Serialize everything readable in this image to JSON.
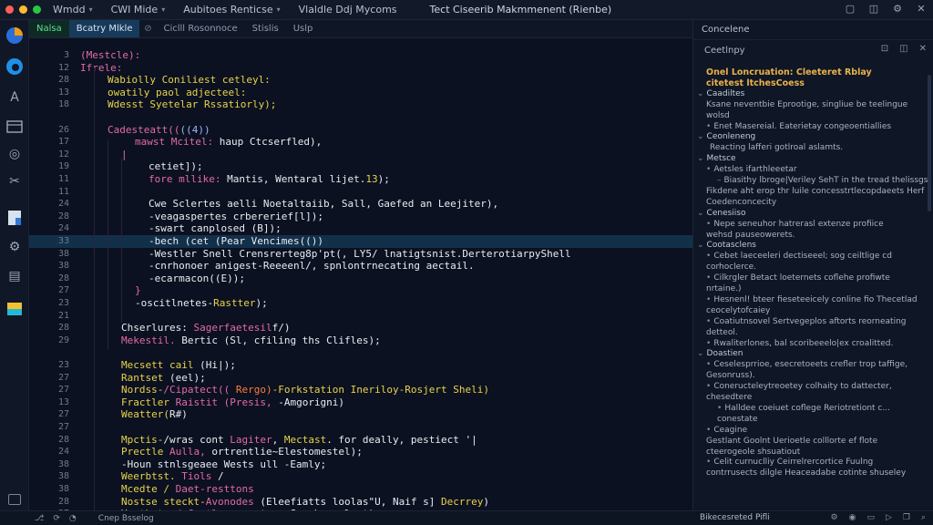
{
  "window": {
    "menus": [
      "Wmdd",
      "CWI Mide",
      "Aubitoes Renticse"
    ],
    "title": "Vlaldle Ddj Mycoms",
    "subtitle": "Tect Ciseerib Makmmenent (Rienbe)",
    "traffic_colors": [
      "#ff5f57",
      "#febc2e",
      "#28c840"
    ]
  },
  "activity_icons": [
    "browser-icon",
    "edge-icon",
    "text-icon",
    "terminal-icon",
    "target-icon",
    "tools-icon",
    "document-icon",
    "settings-icon",
    "file-icon",
    "extension-icon"
  ],
  "tabs": [
    {
      "label": "Nalsa",
      "style": "green"
    },
    {
      "label": "Bcatry Mlkle",
      "style": "active"
    },
    {
      "label": "Ciclll Rosonnoce",
      "style": "normal"
    },
    {
      "label": "Stislis",
      "style": "normal"
    },
    {
      "label": "Uslp",
      "style": "normal"
    }
  ],
  "code": [
    {
      "n": "3",
      "indent": 0,
      "segs": [
        [
          "(Mestcle):",
          "#e36aa8"
        ]
      ]
    },
    {
      "n": "12",
      "indent": 0,
      "segs": [
        [
          "Ifrele:",
          "#e36aa8"
        ]
      ]
    },
    {
      "n": "28",
      "indent": 2,
      "segs": [
        [
          "Wabiolly Coniliest cetleyl:",
          "#e9d34a"
        ]
      ]
    },
    {
      "n": "13",
      "indent": 2,
      "segs": [
        [
          "owatily paol adjecteel:",
          "#e9d34a"
        ]
      ]
    },
    {
      "n": "18",
      "indent": 2,
      "segs": [
        [
          "Wdesst Syetelar Rssatiorly);",
          "#e9d34a"
        ]
      ]
    },
    {
      "n": "",
      "indent": 0,
      "segs": []
    },
    {
      "n": "26",
      "indent": 2,
      "segs": [
        [
          "Cadesteatt((",
          "#e36aa8"
        ],
        [
          "((4))",
          "#9fb4ff"
        ]
      ]
    },
    {
      "n": "17",
      "indent": 4,
      "segs": [
        [
          "mawst Mcitel: ",
          "#e36aa8"
        ],
        [
          "haup Ctcserfled),",
          "#e8ecf2"
        ]
      ]
    },
    {
      "n": "12",
      "indent": 3,
      "segs": [
        [
          "|",
          "#e36aa8"
        ]
      ]
    },
    {
      "n": "19",
      "indent": 5,
      "segs": [
        [
          "cetiet]);",
          "#e8ecf2"
        ]
      ]
    },
    {
      "n": "11",
      "indent": 5,
      "segs": [
        [
          "fore mllike: ",
          "#e36aa8"
        ],
        [
          "Mantis, Wentaral lijet.",
          "#e8ecf2"
        ],
        [
          "13",
          "#e9d34a"
        ],
        [
          ");",
          "#e8ecf2"
        ]
      ]
    },
    {
      "n": "11",
      "indent": 0,
      "segs": []
    },
    {
      "n": "24",
      "indent": 5,
      "segs": [
        [
          "Cwe Sclertes aelli Noetaltaiib, Sall, Gaefed an Leejiter),",
          "#e8ecf2"
        ]
      ]
    },
    {
      "n": "28",
      "indent": 5,
      "segs": [
        [
          "-veagaspertes crbererief[l]);",
          "#e8ecf2"
        ]
      ]
    },
    {
      "n": "24",
      "indent": 5,
      "segs": [
        [
          "-swart canplosed (B]);",
          "#e8ecf2"
        ]
      ]
    },
    {
      "n": "33",
      "indent": 5,
      "segs": [
        [
          "-bech (cet (Pear Vencimes(())",
          "#e8ecf2"
        ]
      ],
      "hl": true
    },
    {
      "n": "38",
      "indent": 5,
      "segs": [
        [
          "-Westler Snell Crensrerteg8p'pt(, LY5/ lnatigtsnist.DerterotiarpyShell",
          "#e8ecf2"
        ]
      ]
    },
    {
      "n": "38",
      "indent": 5,
      "segs": [
        [
          "-cnrhonoer anigest-Reeeenl/, spnlontrnecating aectail.",
          "#e8ecf2"
        ]
      ]
    },
    {
      "n": "28",
      "indent": 5,
      "segs": [
        [
          "-ecarmacon((E));",
          "#e8ecf2"
        ]
      ]
    },
    {
      "n": "27",
      "indent": 4,
      "segs": [
        [
          "}",
          "#e36aa8"
        ]
      ]
    },
    {
      "n": "23",
      "indent": 4,
      "segs": [
        [
          "-oscitlnetes-",
          "#e8ecf2"
        ],
        [
          "Rastter",
          "#e9d34a"
        ],
        [
          ");",
          "#e8ecf2"
        ]
      ]
    },
    {
      "n": "21",
      "indent": 0,
      "segs": []
    },
    {
      "n": "28",
      "indent": 3,
      "segs": [
        [
          "Chserlures: ",
          "#e8ecf2"
        ],
        [
          "Sagerfaetesil",
          "#e36aa8"
        ],
        [
          "f/)",
          "#e8ecf2"
        ]
      ]
    },
    {
      "n": "29",
      "indent": 3,
      "segs": [
        [
          "Mekestil. ",
          "#e36aa8"
        ],
        [
          "Bertic (Sl, cfiling ths Clifles);",
          "#e8ecf2"
        ]
      ]
    },
    {
      "n": "",
      "indent": 0,
      "segs": []
    },
    {
      "n": "23",
      "indent": 3,
      "segs": [
        [
          "Mecsett cail ",
          "#e9d34a"
        ],
        [
          "(Hi|);",
          "#e8ecf2"
        ]
      ]
    },
    {
      "n": "27",
      "indent": 3,
      "segs": [
        [
          "Rantset ",
          "#e9d34a"
        ],
        [
          "(eel);",
          "#e8ecf2"
        ]
      ]
    },
    {
      "n": "27",
      "indent": 3,
      "segs": [
        [
          "Nordss-",
          "#e9d34a"
        ],
        [
          "/Cipatect((",
          "#e36aa8"
        ],
        [
          " Rergo)",
          "#ff7a3d"
        ],
        [
          "-Forkstation ",
          "#e9d34a"
        ],
        [
          "Ineriloy-Rosjert Sheli)",
          "#e9d34a"
        ]
      ]
    },
    {
      "n": "13",
      "indent": 3,
      "segs": [
        [
          "Fractler ",
          "#e9d34a"
        ],
        [
          "Raistit ",
          "#e36aa8"
        ],
        [
          "(Presis, ",
          "#e36aa8"
        ],
        [
          "-Amgorigni)",
          "#e8ecf2"
        ]
      ]
    },
    {
      "n": "27",
      "indent": 3,
      "segs": [
        [
          "Weatter(",
          "#e9d34a"
        ],
        [
          "R#)",
          "#e8ecf2"
        ]
      ]
    },
    {
      "n": "27",
      "indent": 0,
      "segs": []
    },
    {
      "n": "28",
      "indent": 3,
      "segs": [
        [
          "Mpctis-",
          "#e9d34a"
        ],
        [
          "/wras cont ",
          "#e8ecf2"
        ],
        [
          "Lagiter",
          "#e36aa8"
        ],
        [
          ", ",
          "#e8ecf2"
        ],
        [
          "Mectast",
          "#e9d34a"
        ],
        [
          ". for deally, pestiect '|",
          "#e8ecf2"
        ]
      ]
    },
    {
      "n": "24",
      "indent": 3,
      "segs": [
        [
          "Prectle ",
          "#e9d34a"
        ],
        [
          "Aulla, ",
          "#e36aa8"
        ],
        [
          "ortrentlie~Elestomestel);",
          "#e8ecf2"
        ]
      ]
    },
    {
      "n": "38",
      "indent": 3,
      "segs": [
        [
          "-Houn stnlsgeaee Wests ull -Eamly;",
          "#e8ecf2"
        ]
      ]
    },
    {
      "n": "38",
      "indent": 3,
      "segs": [
        [
          "Weerbtst. ",
          "#e9d34a"
        ],
        [
          "Tiols",
          "#e36aa8"
        ],
        [
          " /",
          "#e8ecf2"
        ]
      ]
    },
    {
      "n": "38",
      "indent": 3,
      "segs": [
        [
          "Mcedte / ",
          "#e9d34a"
        ],
        [
          "Daet-resttons",
          "#e36aa8"
        ]
      ]
    },
    {
      "n": "28",
      "indent": 3,
      "segs": [
        [
          "Nostse steckt-",
          "#e9d34a"
        ],
        [
          "Avonodes ",
          "#e36aa8"
        ],
        [
          "(Eleefiatts loolas\"U, Naif s] ",
          "#e8ecf2"
        ],
        [
          "Decrrey",
          "#e9d34a"
        ],
        [
          ")",
          "#e8ecf2"
        ]
      ]
    },
    {
      "n": "37",
      "indent": 3,
      "segs": [
        [
          "Vanthet ",
          "#e9d34a"
        ],
        [
          "s/-Ccatla--",
          "#e36aa8"
        ],
        [
          "amaets - Sogcheseolent);",
          "#e8ecf2"
        ]
      ]
    }
  ],
  "panel": {
    "header": "Concelene",
    "subheader": "Ceetlnpy",
    "rows": [
      {
        "kind": "title",
        "text": "Onel Loncruation: Cleeteret Rblay"
      },
      {
        "kind": "title",
        "text": "citetest ltchesCoess"
      },
      {
        "kind": "section",
        "text": "Caadiltes",
        "arrow": "⌄"
      },
      {
        "kind": "item",
        "text": "Ksane neventbie Eprootige, singliue be teelingue",
        "pad": 14
      },
      {
        "kind": "item",
        "text": "wolsd",
        "pad": 14
      },
      {
        "kind": "item",
        "text": "Enet Masereial. Eaterietay congeoentiallies",
        "pad": 14,
        "arrow": "•"
      },
      {
        "kind": "section",
        "text": "Ceonleneng",
        "arrow": "⌄"
      },
      {
        "kind": "item",
        "text": "Reacting lafferi gotlroal aslamts.",
        "pad": 18
      },
      {
        "kind": "section",
        "text": "Metsce",
        "arrow": "⌄"
      },
      {
        "kind": "item",
        "text": "Aetsles ifarthleeetar",
        "pad": 14,
        "arrow": "•"
      },
      {
        "kind": "item",
        "text": "Biasithy lbroge|Veriley SehT in the tread thelissgs",
        "pad": 26,
        "arrow": "–"
      },
      {
        "kind": "item",
        "text": "Fikdene aht erop thr luile concesstrtlecopdaeets Herf",
        "pad": 14
      },
      {
        "kind": "item",
        "text": "Coedenconcecity",
        "pad": 14
      },
      {
        "kind": "section",
        "text": "Cenesiiso",
        "arrow": "⌄"
      },
      {
        "kind": "item",
        "text": "Nepe seneuhor hatrerasl extenze profiice",
        "pad": 14,
        "arrow": "•"
      },
      {
        "kind": "item",
        "text": "wehsd pauseowerets.",
        "pad": 14
      },
      {
        "kind": "section",
        "text": "Cootasclens",
        "arrow": "⌄"
      },
      {
        "kind": "item",
        "text": "Cebet laeceeleri dectiseeel; sog ceiltlige cd",
        "pad": 14,
        "arrow": "•"
      },
      {
        "kind": "item",
        "text": "corhoclerce.",
        "pad": 14
      },
      {
        "kind": "item",
        "text": "Cilkrgler Betact loeternets coflehe profiwte",
        "pad": 14,
        "arrow": "•"
      },
      {
        "kind": "item",
        "text": "nrtaine.)",
        "pad": 14
      },
      {
        "kind": "item",
        "text": "Hesnenl! bteer fieseteeicely conline fio Thecetlad",
        "pad": 14,
        "arrow": "•"
      },
      {
        "kind": "item",
        "text": "ceocelytofcaiey",
        "pad": 14
      },
      {
        "kind": "item",
        "text": "Coatiutnsovel Sertvegeplos aftorts reorneating",
        "pad": 14,
        "arrow": "•"
      },
      {
        "kind": "item",
        "text": "detteol.",
        "pad": 14
      },
      {
        "kind": "item",
        "text": "Rwaliterlones, bal scoribeeelo|ex croalitted.",
        "pad": 14,
        "arrow": "•"
      },
      {
        "kind": "section",
        "text": "Doastien",
        "arrow": "⌄"
      },
      {
        "kind": "item",
        "text": "Ceselesprrioe, esecretoeets crefler trop taffige,",
        "pad": 14,
        "arrow": "•"
      },
      {
        "kind": "item",
        "text": "Gesonruss).",
        "pad": 14
      },
      {
        "kind": "item",
        "text": "Coneructeleytreoetey colhaity to dattecter,",
        "pad": 14,
        "arrow": "•"
      },
      {
        "kind": "item",
        "text": "chesedtere",
        "pad": 14
      },
      {
        "kind": "item",
        "text": "Halldee coeiuet coflege Reriotretiont c...",
        "pad": 26,
        "arrow": "•"
      },
      {
        "kind": "item",
        "text": "conestate",
        "pad": 26
      },
      {
        "kind": "item",
        "text": "Ceagine",
        "pad": 14,
        "arrow": "•"
      },
      {
        "kind": "item",
        "text": "Gestlant Goolnt Uerioetle colllorte ef flote",
        "pad": 14
      },
      {
        "kind": "item",
        "text": "cteerogeole shsuatiout",
        "pad": 14
      },
      {
        "kind": "item",
        "text": "Celit curnuclliy Ceirrelrercortice Fuulng",
        "pad": 14,
        "arrow": "•"
      },
      {
        "kind": "item",
        "text": "contrrusects dilgle Heaceadabe cotinte shuseley",
        "pad": 14
      }
    ]
  },
  "status": {
    "left_icons": [
      "branch-icon",
      "sync-icon",
      "bell-icon"
    ],
    "text": "Cnep Bsselog",
    "file": "Bikecesreted Pifli",
    "right_icons": [
      "settings-icon",
      "account-icon",
      "layout-icon",
      "play-icon",
      "copy-icon",
      "search-icon"
    ]
  }
}
